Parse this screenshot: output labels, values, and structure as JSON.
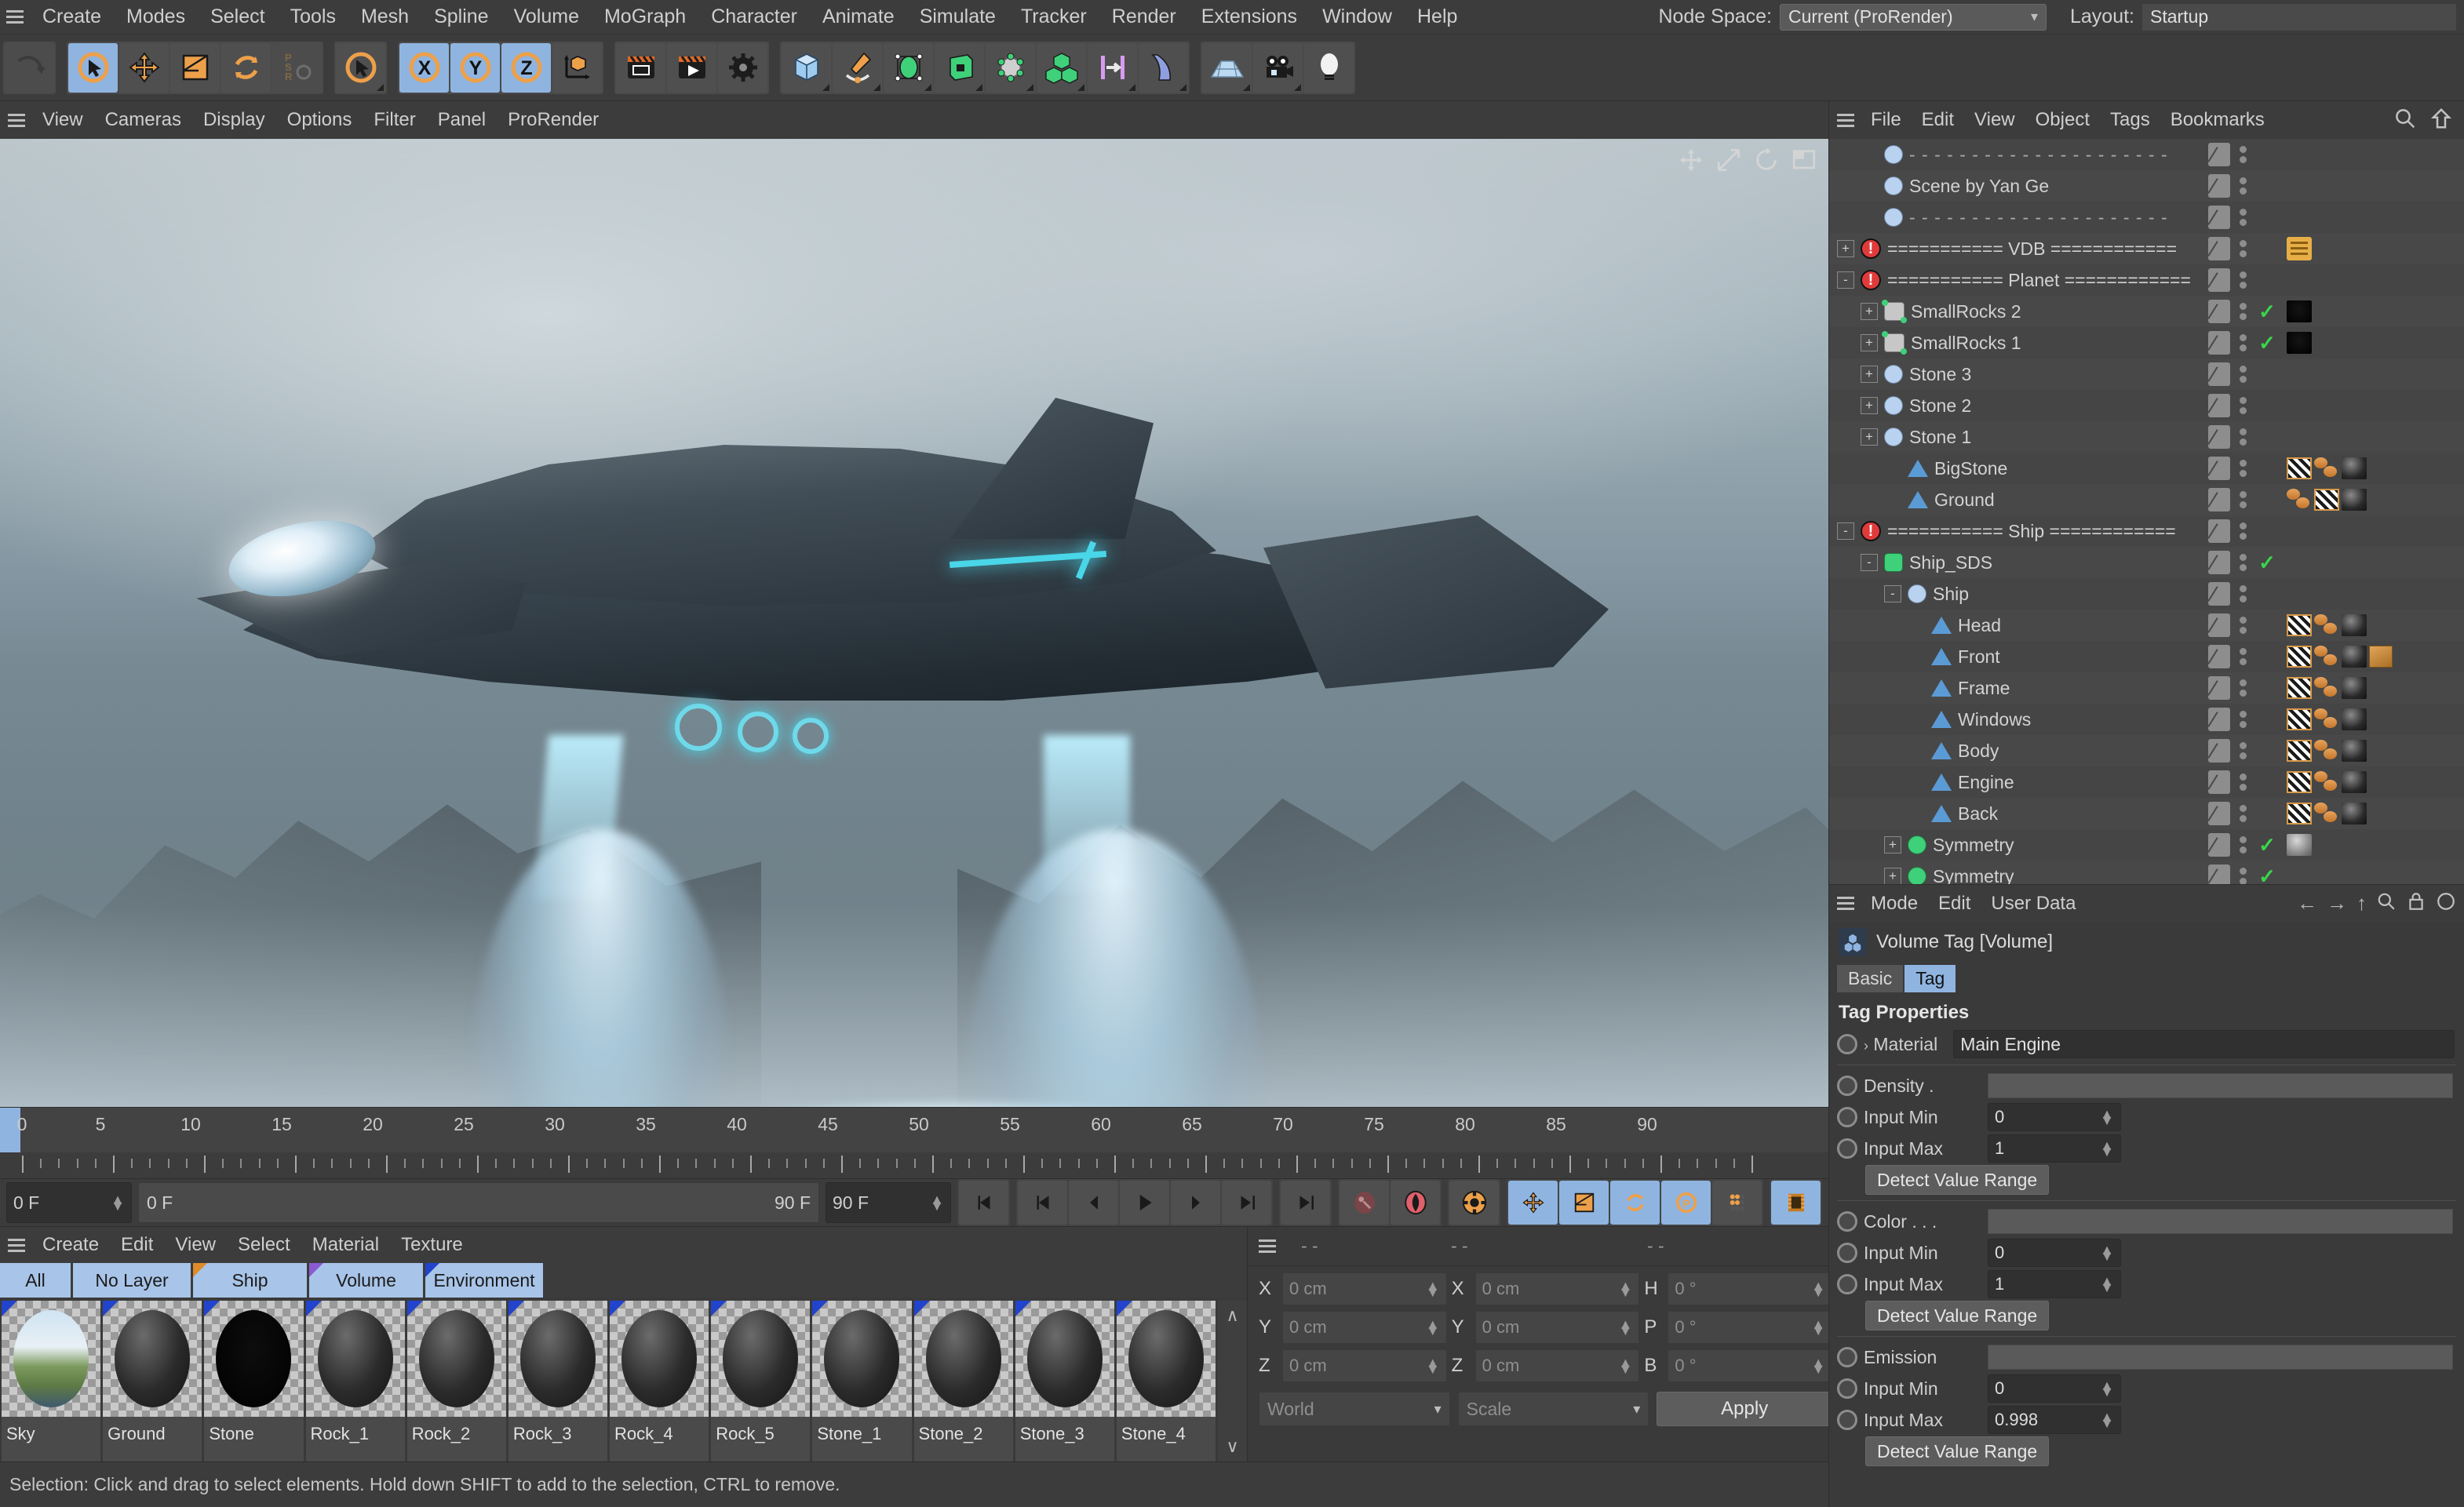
{
  "menubar": {
    "items": [
      "Create",
      "Modes",
      "Select",
      "Tools",
      "Mesh",
      "Spline",
      "Volume",
      "MoGraph",
      "Character",
      "Animate",
      "Simulate",
      "Tracker",
      "Render",
      "Extensions",
      "Window",
      "Help"
    ],
    "node_space_label": "Node Space:",
    "node_space_value": "Current (ProRender)",
    "layout_label": "Layout:",
    "layout_value": "Startup"
  },
  "viewport_menu": {
    "items": [
      "View",
      "Cameras",
      "Display",
      "Options",
      "Filter",
      "Panel",
      "ProRender"
    ]
  },
  "timeline": {
    "ticks": [
      "0",
      "5",
      "10",
      "15",
      "20",
      "25",
      "30",
      "35",
      "40",
      "45",
      "50",
      "55",
      "60",
      "65",
      "70",
      "75",
      "80",
      "85",
      "90"
    ],
    "current_frame": "0 F",
    "preview_start": "0 F",
    "preview_end": "90 F",
    "end_frame": "90 F",
    "field_left": "0 F"
  },
  "material_manager": {
    "menu": [
      "Create",
      "Edit",
      "View",
      "Select",
      "Material",
      "Texture"
    ],
    "layers": [
      "All",
      "No Layer",
      "Ship",
      "Volume",
      "Environment"
    ],
    "materials": [
      "Sky",
      "Ground",
      "Stone",
      "Rock_1",
      "Rock_2",
      "Rock_3",
      "Rock_4",
      "Rock_5",
      "Stone_1",
      "Stone_2",
      "Stone_3",
      "Stone_4"
    ]
  },
  "coordinates": {
    "dash": "- -",
    "rows": [
      {
        "label": "X",
        "pos": "0 cm",
        "label2": "X",
        "size": "0 cm",
        "label3": "H",
        "rot": "0 °"
      },
      {
        "label": "Y",
        "pos": "0 cm",
        "label2": "Y",
        "size": "0 cm",
        "label3": "P",
        "rot": "0 °"
      },
      {
        "label": "Z",
        "pos": "0 cm",
        "label2": "Z",
        "size": "0 cm",
        "label3": "B",
        "rot": "0 °"
      }
    ],
    "system": "World",
    "mode": "Scale",
    "apply": "Apply"
  },
  "statusbar": {
    "text": "Selection: Click and drag to select elements. Hold down SHIFT to add to the selection, CTRL to remove."
  },
  "object_manager": {
    "menu": [
      "File",
      "Edit",
      "View",
      "Object",
      "Tags",
      "Bookmarks"
    ],
    "rows": [
      {
        "name": "- - - - - - - - - - - - - - - - - - - - -",
        "indent": 1,
        "icon": "null-icon",
        "dash": true,
        "expand": "",
        "check": false,
        "tags": []
      },
      {
        "name": "Scene by Yan Ge",
        "indent": 1,
        "icon": "null-icon",
        "dash": false,
        "expand": "",
        "check": false,
        "tags": []
      },
      {
        "name": "- - - - - - - - - - - - - - - - - - - - -",
        "indent": 1,
        "icon": "null-icon",
        "dash": true,
        "expand": "",
        "check": false,
        "tags": []
      },
      {
        "name": "=========== VDB ============",
        "indent": 0,
        "icon": "error-icon",
        "dash": false,
        "expand": "+",
        "check": false,
        "tags": [
          "note"
        ]
      },
      {
        "name": "=========== Planet ============",
        "indent": 0,
        "icon": "error-icon",
        "dash": false,
        "expand": "-",
        "check": false,
        "tags": []
      },
      {
        "name": "SmallRocks 2",
        "indent": 1,
        "icon": "cloner-icon",
        "dash": false,
        "expand": "+",
        "check": true,
        "tags": [
          "black"
        ]
      },
      {
        "name": "SmallRocks 1",
        "indent": 1,
        "icon": "cloner-icon",
        "dash": false,
        "expand": "+",
        "check": true,
        "tags": [
          "black"
        ]
      },
      {
        "name": "Stone 3",
        "indent": 1,
        "icon": "null-icon",
        "dash": false,
        "expand": "+",
        "check": false,
        "tags": []
      },
      {
        "name": "Stone 2",
        "indent": 1,
        "icon": "null-icon",
        "dash": false,
        "expand": "+",
        "check": false,
        "tags": []
      },
      {
        "name": "Stone 1",
        "indent": 1,
        "icon": "null-icon",
        "dash": false,
        "expand": "+",
        "check": false,
        "tags": []
      },
      {
        "name": "BigStone",
        "indent": 2,
        "icon": "poly-icon",
        "dash": false,
        "expand": "",
        "check": false,
        "tags": [
          "uv",
          "phong",
          "mat"
        ]
      },
      {
        "name": "Ground",
        "indent": 2,
        "icon": "poly-icon",
        "dash": false,
        "expand": "",
        "check": false,
        "tags": [
          "phong",
          "uv",
          "mat"
        ]
      },
      {
        "name": "=========== Ship ============",
        "indent": 0,
        "icon": "error-icon",
        "dash": false,
        "expand": "-",
        "check": false,
        "tags": []
      },
      {
        "name": "Ship_SDS",
        "indent": 1,
        "icon": "sds-icon",
        "dash": false,
        "expand": "-",
        "check": true,
        "tags": []
      },
      {
        "name": "Ship",
        "indent": 2,
        "icon": "null-icon",
        "dash": false,
        "expand": "-",
        "check": false,
        "tags": []
      },
      {
        "name": "Head",
        "indent": 3,
        "icon": "poly-icon",
        "dash": false,
        "expand": "",
        "check": false,
        "tags": [
          "uv",
          "phong",
          "mat"
        ]
      },
      {
        "name": "Front",
        "indent": 3,
        "icon": "poly-icon",
        "dash": false,
        "expand": "",
        "check": false,
        "tags": [
          "uv",
          "phong",
          "mat",
          "box"
        ]
      },
      {
        "name": "Frame",
        "indent": 3,
        "icon": "poly-icon",
        "dash": false,
        "expand": "",
        "check": false,
        "tags": [
          "uv",
          "phong",
          "mat"
        ]
      },
      {
        "name": "Windows",
        "indent": 3,
        "icon": "poly-icon",
        "dash": false,
        "expand": "",
        "check": false,
        "tags": [
          "uv",
          "phong",
          "mat"
        ]
      },
      {
        "name": "Body",
        "indent": 3,
        "icon": "poly-icon",
        "dash": false,
        "expand": "",
        "check": false,
        "tags": [
          "uv",
          "phong",
          "mat"
        ]
      },
      {
        "name": "Engine",
        "indent": 3,
        "icon": "poly-icon",
        "dash": false,
        "expand": "",
        "check": false,
        "tags": [
          "uv",
          "phong",
          "mat"
        ]
      },
      {
        "name": "Back",
        "indent": 3,
        "icon": "poly-icon",
        "dash": false,
        "expand": "",
        "check": false,
        "tags": [
          "uv",
          "phong",
          "mat"
        ]
      },
      {
        "name": "Symmetry",
        "indent": 2,
        "icon": "symmetry-icon",
        "dash": false,
        "expand": "+",
        "check": true,
        "tags": [
          "grey"
        ]
      },
      {
        "name": "Symmetry",
        "indent": 2,
        "icon": "symmetry-icon",
        "dash": false,
        "expand": "+",
        "check": true,
        "tags": []
      }
    ]
  },
  "attribute_manager": {
    "menu": [
      "Mode",
      "Edit",
      "User Data"
    ],
    "title": "Volume Tag [Volume]",
    "tabs": [
      {
        "label": "Basic",
        "active": false
      },
      {
        "label": "Tag",
        "active": true
      }
    ],
    "section": "Tag Properties",
    "material_label": "Material",
    "material_value": "Main Engine",
    "groups": [
      {
        "name": "Density .",
        "min_label": "Input Min",
        "min": "0",
        "max_label": "Input Max",
        "max": "1",
        "button": "Detect Value Range"
      },
      {
        "name": "Color . . .",
        "min_label": "Input Min",
        "min": "0",
        "max_label": "Input Max",
        "max": "1",
        "button": "Detect Value Range"
      },
      {
        "name": "Emission",
        "min_label": "Input Min",
        "min": "0",
        "max_label": "Input Max",
        "max": "0.998",
        "button": "Detect Value Range"
      }
    ]
  },
  "toolbar": {
    "buttons": [
      {
        "name": "undo-icon",
        "active": false,
        "dim": true
      },
      {
        "name": "live-selection-icon",
        "active": true,
        "dim": false
      },
      {
        "name": "move-icon",
        "active": false,
        "dim": false
      },
      {
        "name": "scale-icon",
        "active": false,
        "dim": false
      },
      {
        "name": "rotate-icon",
        "active": false,
        "dim": false
      },
      {
        "name": "psr-icon",
        "active": false,
        "dim": true
      },
      {
        "name": "select-tool-icon",
        "active": false,
        "dim": false
      },
      {
        "name": "x-axis-icon",
        "active": true,
        "dim": false
      },
      {
        "name": "y-axis-icon",
        "active": true,
        "dim": false
      },
      {
        "name": "z-axis-icon",
        "active": true,
        "dim": false
      },
      {
        "name": "world-coordinate-icon",
        "active": false,
        "dim": false
      },
      {
        "name": "render-view-icon",
        "active": false,
        "dim": false
      },
      {
        "name": "render-queue-icon",
        "active": false,
        "dim": false
      },
      {
        "name": "render-settings-icon",
        "active": false,
        "dim": false
      },
      {
        "name": "cube-primitive-icon",
        "active": false,
        "dim": false
      },
      {
        "name": "pen-spline-icon",
        "active": false,
        "dim": false
      },
      {
        "name": "nurbs-icon",
        "active": false,
        "dim": false
      },
      {
        "name": "array-icon",
        "active": false,
        "dim": false
      },
      {
        "name": "mograph-icon",
        "active": false,
        "dim": false
      },
      {
        "name": "volume-icon",
        "active": false,
        "dim": false
      },
      {
        "name": "field-icon",
        "active": false,
        "dim": false
      },
      {
        "name": "deformer-icon",
        "active": false,
        "dim": false
      },
      {
        "name": "floor-icon",
        "active": false,
        "dim": false
      },
      {
        "name": "camera-icon",
        "active": false,
        "dim": false
      },
      {
        "name": "light-icon",
        "active": false,
        "dim": false
      }
    ]
  },
  "transport": {
    "buttons": [
      "go-to-start",
      "go-to-previous-key",
      "step-back",
      "play",
      "step-forward",
      "go-to-end",
      "go-to-next-key",
      "record-key",
      "autokey",
      "keyframe-settings",
      "position-key",
      "scale-key",
      "rotation-key",
      "param-key",
      "point-key",
      "timeline-icon"
    ]
  }
}
